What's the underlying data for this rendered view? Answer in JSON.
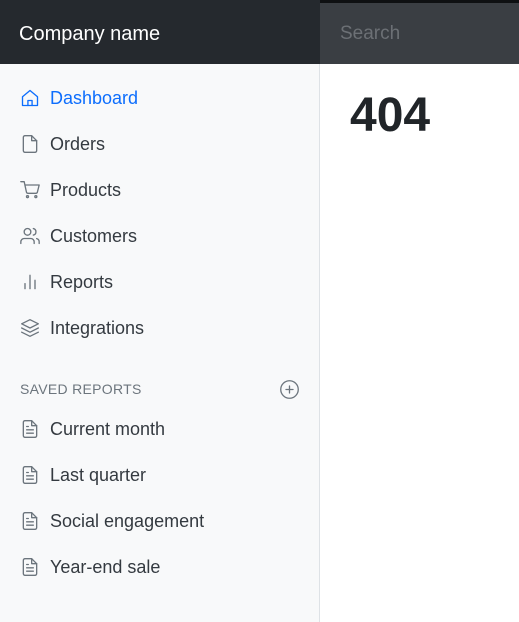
{
  "header": {
    "brand": "Company name",
    "search_placeholder": "Search"
  },
  "sidebar": {
    "items": [
      {
        "label": "Dashboard",
        "icon": "home-icon",
        "active": true
      },
      {
        "label": "Orders",
        "icon": "file-icon",
        "active": false
      },
      {
        "label": "Products",
        "icon": "shopping-cart-icon",
        "active": false
      },
      {
        "label": "Customers",
        "icon": "users-icon",
        "active": false
      },
      {
        "label": "Reports",
        "icon": "bar-chart-icon",
        "active": false
      },
      {
        "label": "Integrations",
        "icon": "layers-icon",
        "active": false
      }
    ],
    "saved_reports": {
      "title": "SAVED REPORTS",
      "add_icon": "plus-circle-icon",
      "items": [
        {
          "label": "Current month",
          "icon": "file-text-icon"
        },
        {
          "label": "Last quarter",
          "icon": "file-text-icon"
        },
        {
          "label": "Social engagement",
          "icon": "file-text-icon"
        },
        {
          "label": "Year-end sale",
          "icon": "file-text-icon"
        }
      ]
    }
  },
  "main": {
    "title": "404"
  },
  "colors": {
    "topbar": "#212529",
    "accent": "#0d6efd",
    "sidebar_bg": "#f8f9fa"
  }
}
